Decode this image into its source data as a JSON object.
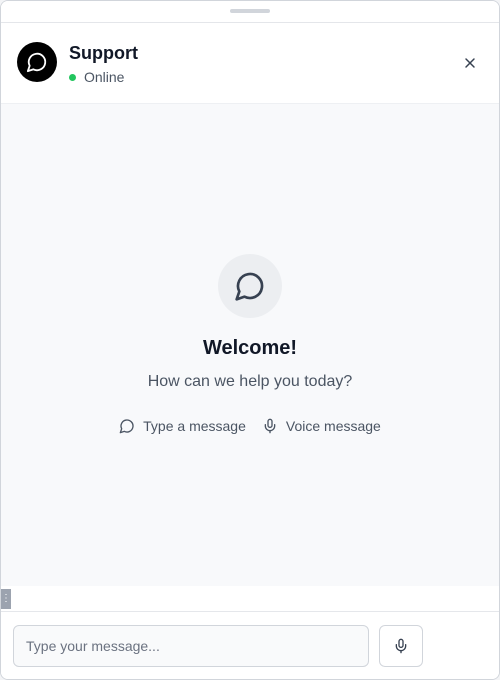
{
  "header": {
    "title": "Support",
    "status_text": "Online",
    "status_color": "#22c55e",
    "avatar_icon": "chat-bubble-icon",
    "close_icon": "close-icon"
  },
  "welcome": {
    "icon": "chat-bubble-icon",
    "title": "Welcome!",
    "subtitle": "How can we help you today?",
    "hints": [
      {
        "icon": "chat-bubble-icon",
        "label": "Type a message"
      },
      {
        "icon": "microphone-icon",
        "label": "Voice message"
      }
    ]
  },
  "composer": {
    "placeholder": "Type your message...",
    "value": "",
    "mic_icon": "microphone-icon"
  },
  "colors": {
    "accent": "#000000",
    "background": "#f8f9fb",
    "online": "#22c55e"
  }
}
